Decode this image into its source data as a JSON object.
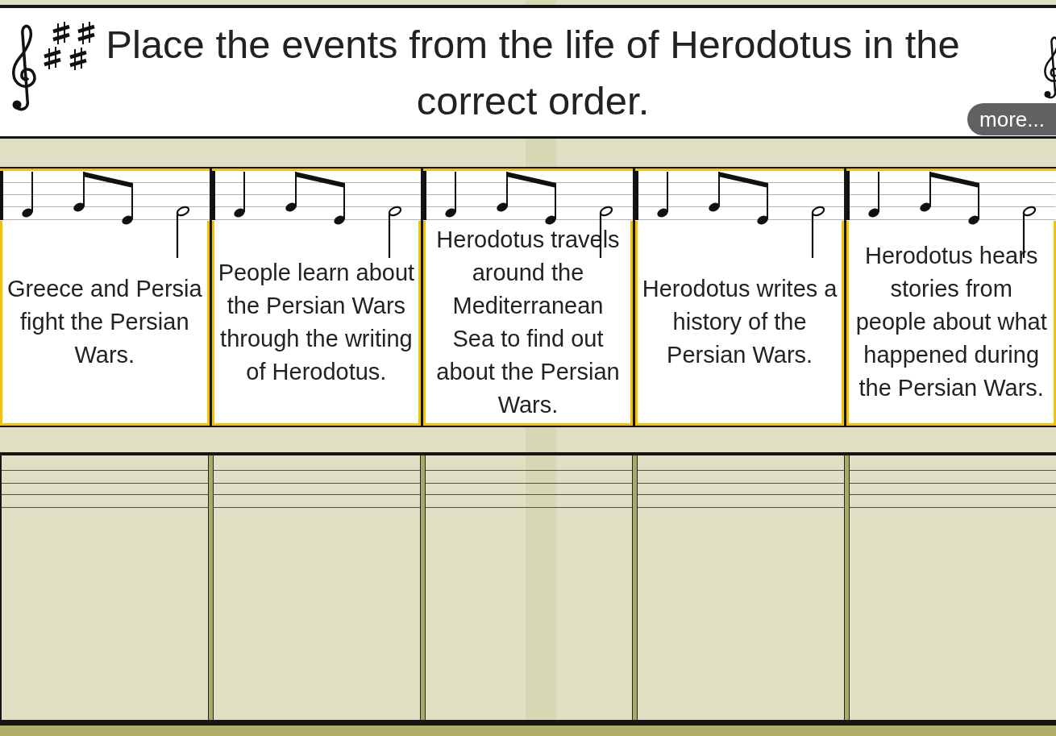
{
  "question": {
    "title": "Place the events from the life of Herodotus in the correct order.",
    "more_button": "more..."
  },
  "events": [
    {
      "text": "Greece and Persia fight the Persian Wars."
    },
    {
      "text": "People learn about the Persian Wars through the writing of Herodotus."
    },
    {
      "text": "Herodotus travels around the Mediterranean Sea to find out about the Persian Wars."
    },
    {
      "text": "Herodotus writes a history of the Persian Wars."
    },
    {
      "text": "Herodotus hears stories from people about what happened during the Persian Wars."
    }
  ]
}
